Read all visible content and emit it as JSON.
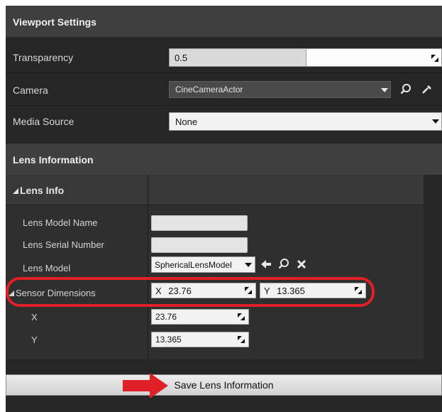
{
  "viewport_settings": {
    "header": "Viewport Settings",
    "transparency": {
      "label": "Transparency",
      "value": "0.5",
      "fill_fraction": 0.5
    },
    "camera": {
      "label": "Camera",
      "value": "CineCameraActor"
    },
    "media_source": {
      "label": "Media Source",
      "value": "None"
    }
  },
  "lens_information": {
    "header": "Lens Information",
    "category": "Lens Info",
    "lens_model_name": {
      "label": "Lens Model Name",
      "value": ""
    },
    "lens_serial_number": {
      "label": "Lens Serial Number",
      "value": ""
    },
    "lens_model": {
      "label": "Lens Model",
      "value": "SphericalLensModel"
    },
    "sensor_dimensions": {
      "label": "Sensor Dimensions",
      "x_label": "X",
      "x_value": "23.76",
      "y_label": "Y",
      "y_value": "13.365"
    },
    "x": {
      "label": "X",
      "value": "23.76"
    },
    "y": {
      "label": "Y",
      "value": "13.365"
    }
  },
  "save_button": "Save Lens Information",
  "colors": {
    "highlight": "#e01f26",
    "panel": "#262626",
    "header": "#3f3f3f"
  }
}
